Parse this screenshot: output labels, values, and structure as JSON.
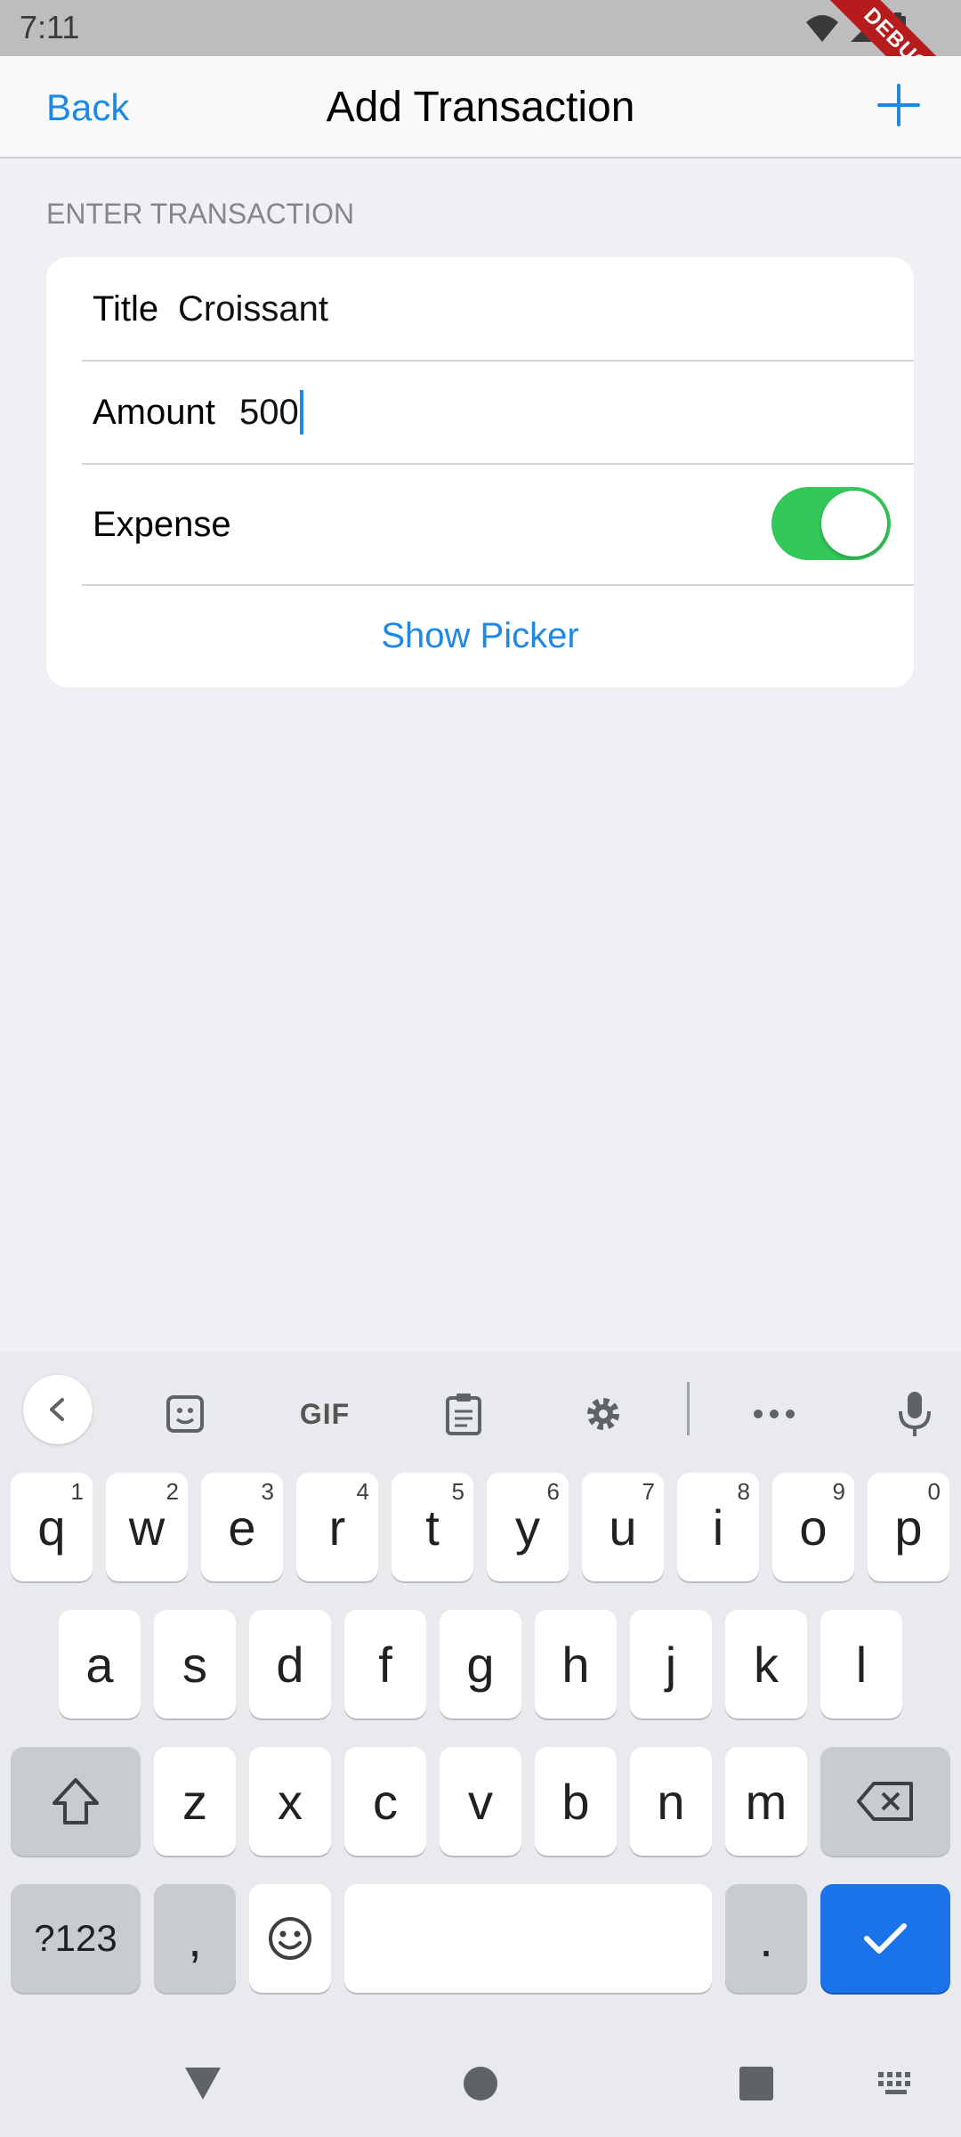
{
  "status_bar": {
    "time": "7:11",
    "debug_label": "DEBUG"
  },
  "nav": {
    "back_label": "Back",
    "title": "Add Transaction",
    "add_icon": "plus-icon"
  },
  "section": {
    "header": "ENTER TRANSACTION"
  },
  "form": {
    "title_label": "Title",
    "title_value": "Croissant",
    "amount_label": "Amount",
    "amount_value": "500",
    "expense_label": "Expense",
    "expense_on": true,
    "picker_button": "Show Picker"
  },
  "keyboard": {
    "toolbar": {
      "gif_label": "GIF"
    },
    "row1": [
      {
        "key": "q",
        "sup": "1"
      },
      {
        "key": "w",
        "sup": "2"
      },
      {
        "key": "e",
        "sup": "3"
      },
      {
        "key": "r",
        "sup": "4"
      },
      {
        "key": "t",
        "sup": "5"
      },
      {
        "key": "y",
        "sup": "6"
      },
      {
        "key": "u",
        "sup": "7"
      },
      {
        "key": "i",
        "sup": "8"
      },
      {
        "key": "o",
        "sup": "9"
      },
      {
        "key": "p",
        "sup": "0"
      }
    ],
    "row2": [
      "a",
      "s",
      "d",
      "f",
      "g",
      "h",
      "j",
      "k",
      "l"
    ],
    "row3": [
      "z",
      "x",
      "c",
      "v",
      "b",
      "n",
      "m"
    ],
    "row4": {
      "symbols": "?123",
      "comma": ",",
      "period": "."
    }
  },
  "colors": {
    "accent": "#1e88e5",
    "toggle_on": "#34c759",
    "enter_key": "#1a73e8"
  }
}
